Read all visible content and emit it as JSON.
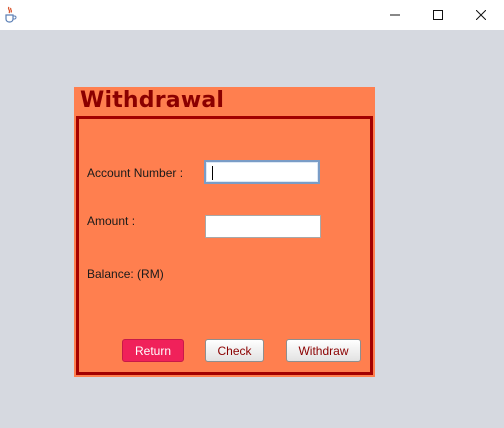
{
  "window": {
    "icon": "java-cup-icon"
  },
  "panel": {
    "title": "Withdrawal",
    "account_number_label": "Account Number :",
    "account_number_value": "",
    "amount_label": "Amount :",
    "amount_value": "",
    "balance_label": "Balance: (RM)",
    "buttons": {
      "return": "Return",
      "check": "Check",
      "withdraw": "Withdraw"
    }
  },
  "colors": {
    "panel_bg": "#ff7f4f",
    "title_color": "#8b0000",
    "border": "#a30000",
    "return_button": "#f0215a"
  }
}
